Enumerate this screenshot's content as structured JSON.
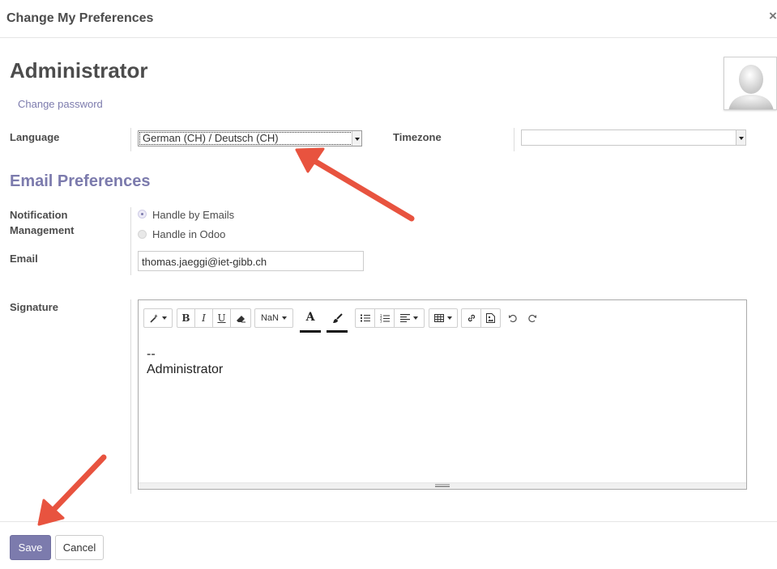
{
  "dialog": {
    "title": "Change My Preferences",
    "close_glyph": "×"
  },
  "user": {
    "name": "Administrator",
    "change_password_label": "Change password"
  },
  "fields": {
    "language": {
      "label": "Language",
      "value": "German (CH) / Deutsch (CH)"
    },
    "timezone": {
      "label": "Timezone",
      "value": ""
    }
  },
  "email_preferences": {
    "title": "Email Preferences",
    "notification": {
      "label_line1": "Notification",
      "label_line2": "Management",
      "options": [
        {
          "label": "Handle by Emails",
          "selected": true
        },
        {
          "label": "Handle in Odoo",
          "selected": false
        }
      ]
    },
    "email": {
      "label": "Email",
      "value": "thomas.jaeggi@iet-gibb.ch"
    }
  },
  "signature": {
    "label": "Signature",
    "toolbar": {
      "font_size_label": "NaN",
      "bold_glyph": "B",
      "italic_glyph": "I",
      "underline_glyph": "U",
      "font_color_glyph": "A"
    },
    "content_line1": "--",
    "content_line2": "Administrator"
  },
  "footer": {
    "save_label": "Save",
    "cancel_label": "Cancel"
  },
  "colors": {
    "accent": "#7c7bad",
    "annotation_arrow": "#e8533f"
  },
  "icons": [
    "close-icon",
    "avatar-placeholder-icon",
    "magic-wand-icon",
    "eraser-icon",
    "paint-brush-icon",
    "bullet-list-icon",
    "numbered-list-icon",
    "align-icon",
    "table-icon",
    "link-icon",
    "image-icon",
    "undo-icon",
    "redo-icon",
    "resize-grip-icon",
    "annotation-arrow"
  ]
}
